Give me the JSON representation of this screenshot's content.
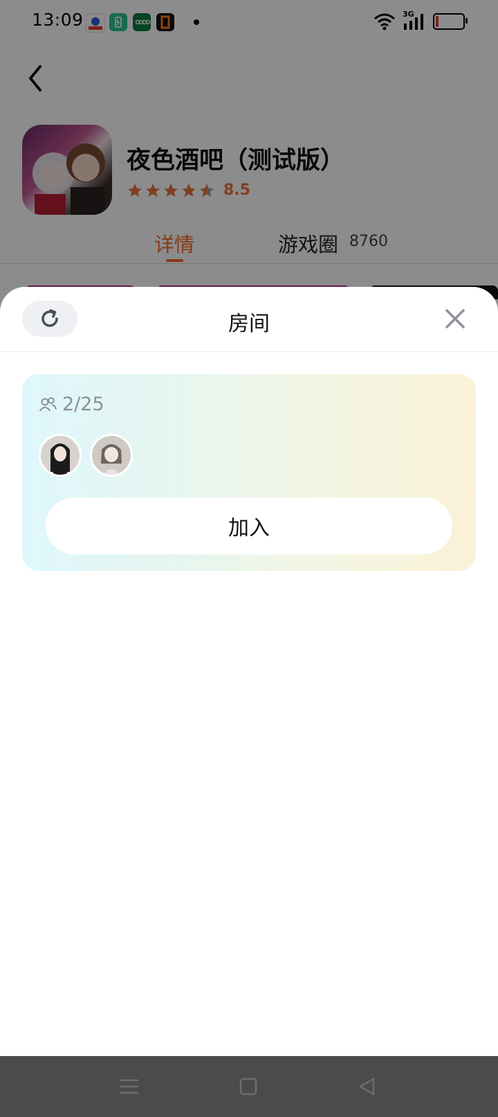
{
  "status_bar": {
    "time": "13:09",
    "network": "3G"
  },
  "app": {
    "title": "夜色酒吧（测试版）",
    "rating": "8.5",
    "rating_stars": 4.5
  },
  "tabs": [
    {
      "label": "详情",
      "active": true
    },
    {
      "label": "游戏圈",
      "count": "8760",
      "active": false
    }
  ],
  "sheet": {
    "title": "房间",
    "room": {
      "player_count": "2/25",
      "join_label": "加入"
    }
  },
  "colors": {
    "accent": "#f56b2a",
    "rating": "#e8743b"
  }
}
